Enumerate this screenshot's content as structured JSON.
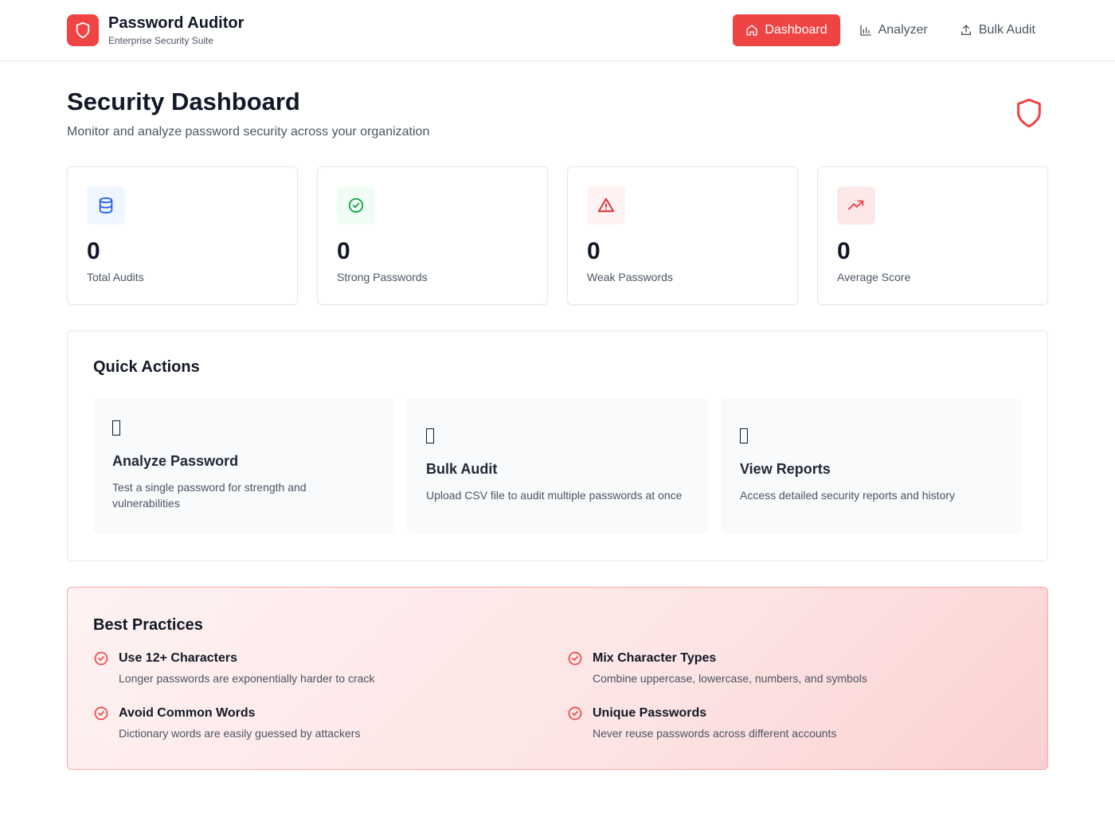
{
  "app": {
    "title": "Password Auditor",
    "subtitle": "Enterprise Security Suite",
    "logo_icon": "shield-icon",
    "accent_color": "#ef4444"
  },
  "nav": {
    "items": [
      {
        "label": "Dashboard",
        "icon": "home-icon",
        "active": true
      },
      {
        "label": "Analyzer",
        "icon": "bar-chart-icon",
        "active": false
      },
      {
        "label": "Bulk Audit",
        "icon": "upload-icon",
        "active": false
      }
    ]
  },
  "page": {
    "title": "Security Dashboard",
    "subtitle": "Monitor and analyze password security across your organization"
  },
  "stats": [
    {
      "value": "0",
      "label": "Total Audits",
      "icon": "database-icon",
      "color": "#2563eb",
      "bg": "#eff6ff"
    },
    {
      "value": "0",
      "label": "Strong Passwords",
      "icon": "check-circle-icon",
      "color": "#16a34a",
      "bg": "#f0fdf4"
    },
    {
      "value": "0",
      "label": "Weak Passwords",
      "icon": "warning-triangle-icon",
      "color": "#dc2626",
      "bg": "#fef2f2"
    },
    {
      "value": "0",
      "label": "Average Score",
      "icon": "trending-up-icon",
      "color": "#ef4444",
      "bg": "#fef2f2"
    }
  ],
  "quick_actions": {
    "title": "Quick Actions",
    "items": [
      {
        "title": "Analyze Password",
        "description": "Test a single password for strength and vulnerabilities"
      },
      {
        "title": "Bulk Audit",
        "description": "Upload CSV file to audit multiple passwords at once"
      },
      {
        "title": "View Reports",
        "description": "Access detailed security reports and history"
      }
    ]
  },
  "best_practices": {
    "title": "Best Practices",
    "items": [
      {
        "title": "Use 12+ Characters",
        "description": "Longer passwords are exponentially harder to crack"
      },
      {
        "title": "Mix Character Types",
        "description": "Combine uppercase, lowercase, numbers, and symbols"
      },
      {
        "title": "Avoid Common Words",
        "description": "Dictionary words are easily guessed by attackers"
      },
      {
        "title": "Unique Passwords",
        "description": "Never reuse passwords across different accounts"
      }
    ]
  }
}
